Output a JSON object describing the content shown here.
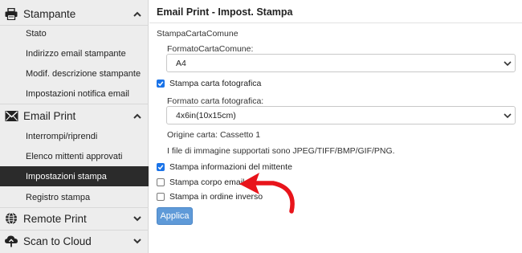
{
  "sidebar": {
    "sections": [
      {
        "label": "Stampante",
        "icon": "printer-icon",
        "chevron": "chevron-up-icon"
      },
      {
        "label": "Email Print",
        "icon": "email-icon",
        "chevron": "chevron-up-icon"
      },
      {
        "label": "Remote Print",
        "icon": "globe-icon",
        "chevron": "chevron-down-icon"
      },
      {
        "label": "Scan to Cloud",
        "icon": "cloud-icon",
        "chevron": "chevron-down-icon"
      }
    ],
    "printer_items": [
      {
        "label": "Stato"
      },
      {
        "label": "Indirizzo email stampante"
      },
      {
        "label": "Modif. descrizione stampante"
      },
      {
        "label": "Impostazioni notifica email"
      }
    ],
    "email_items": [
      {
        "label": "Interrompi/riprendi"
      },
      {
        "label": "Elenco mittenti approvati"
      },
      {
        "label": "Impostazioni stampa",
        "active": true
      },
      {
        "label": "Registro stampa"
      }
    ]
  },
  "main": {
    "title": "Email Print - Impost. Stampa",
    "plain_paper_heading": "StampaCartaComune",
    "plain_paper_size_label": "FormatoCartaComune:",
    "plain_paper_size_value": "A4",
    "photo_paper_checkbox": {
      "label": "Stampa carta fotografica",
      "checked": true
    },
    "photo_paper_size_label": "Formato carta fotografica:",
    "photo_paper_size_value": "4x6in(10x15cm)",
    "paper_source": "Origine carta: Cassetto 1",
    "supported_files": "I file di immagine supportati sono JPEG/TIFF/BMP/GIF/PNG.",
    "checkboxes": [
      {
        "label": "Stampa informazioni del mittente",
        "checked": true
      },
      {
        "label": "Stampa corpo email",
        "checked": false
      },
      {
        "label": "Stampa in ordine inverso",
        "checked": false
      }
    ],
    "apply_label": "Applica"
  },
  "colors": {
    "accent": "#1a73e8",
    "apply_button": "#5f9ad8",
    "active_item_bg": "#2b2b2b",
    "sidebar_bg": "#ededed",
    "annotation_arrow": "#e8141b"
  }
}
